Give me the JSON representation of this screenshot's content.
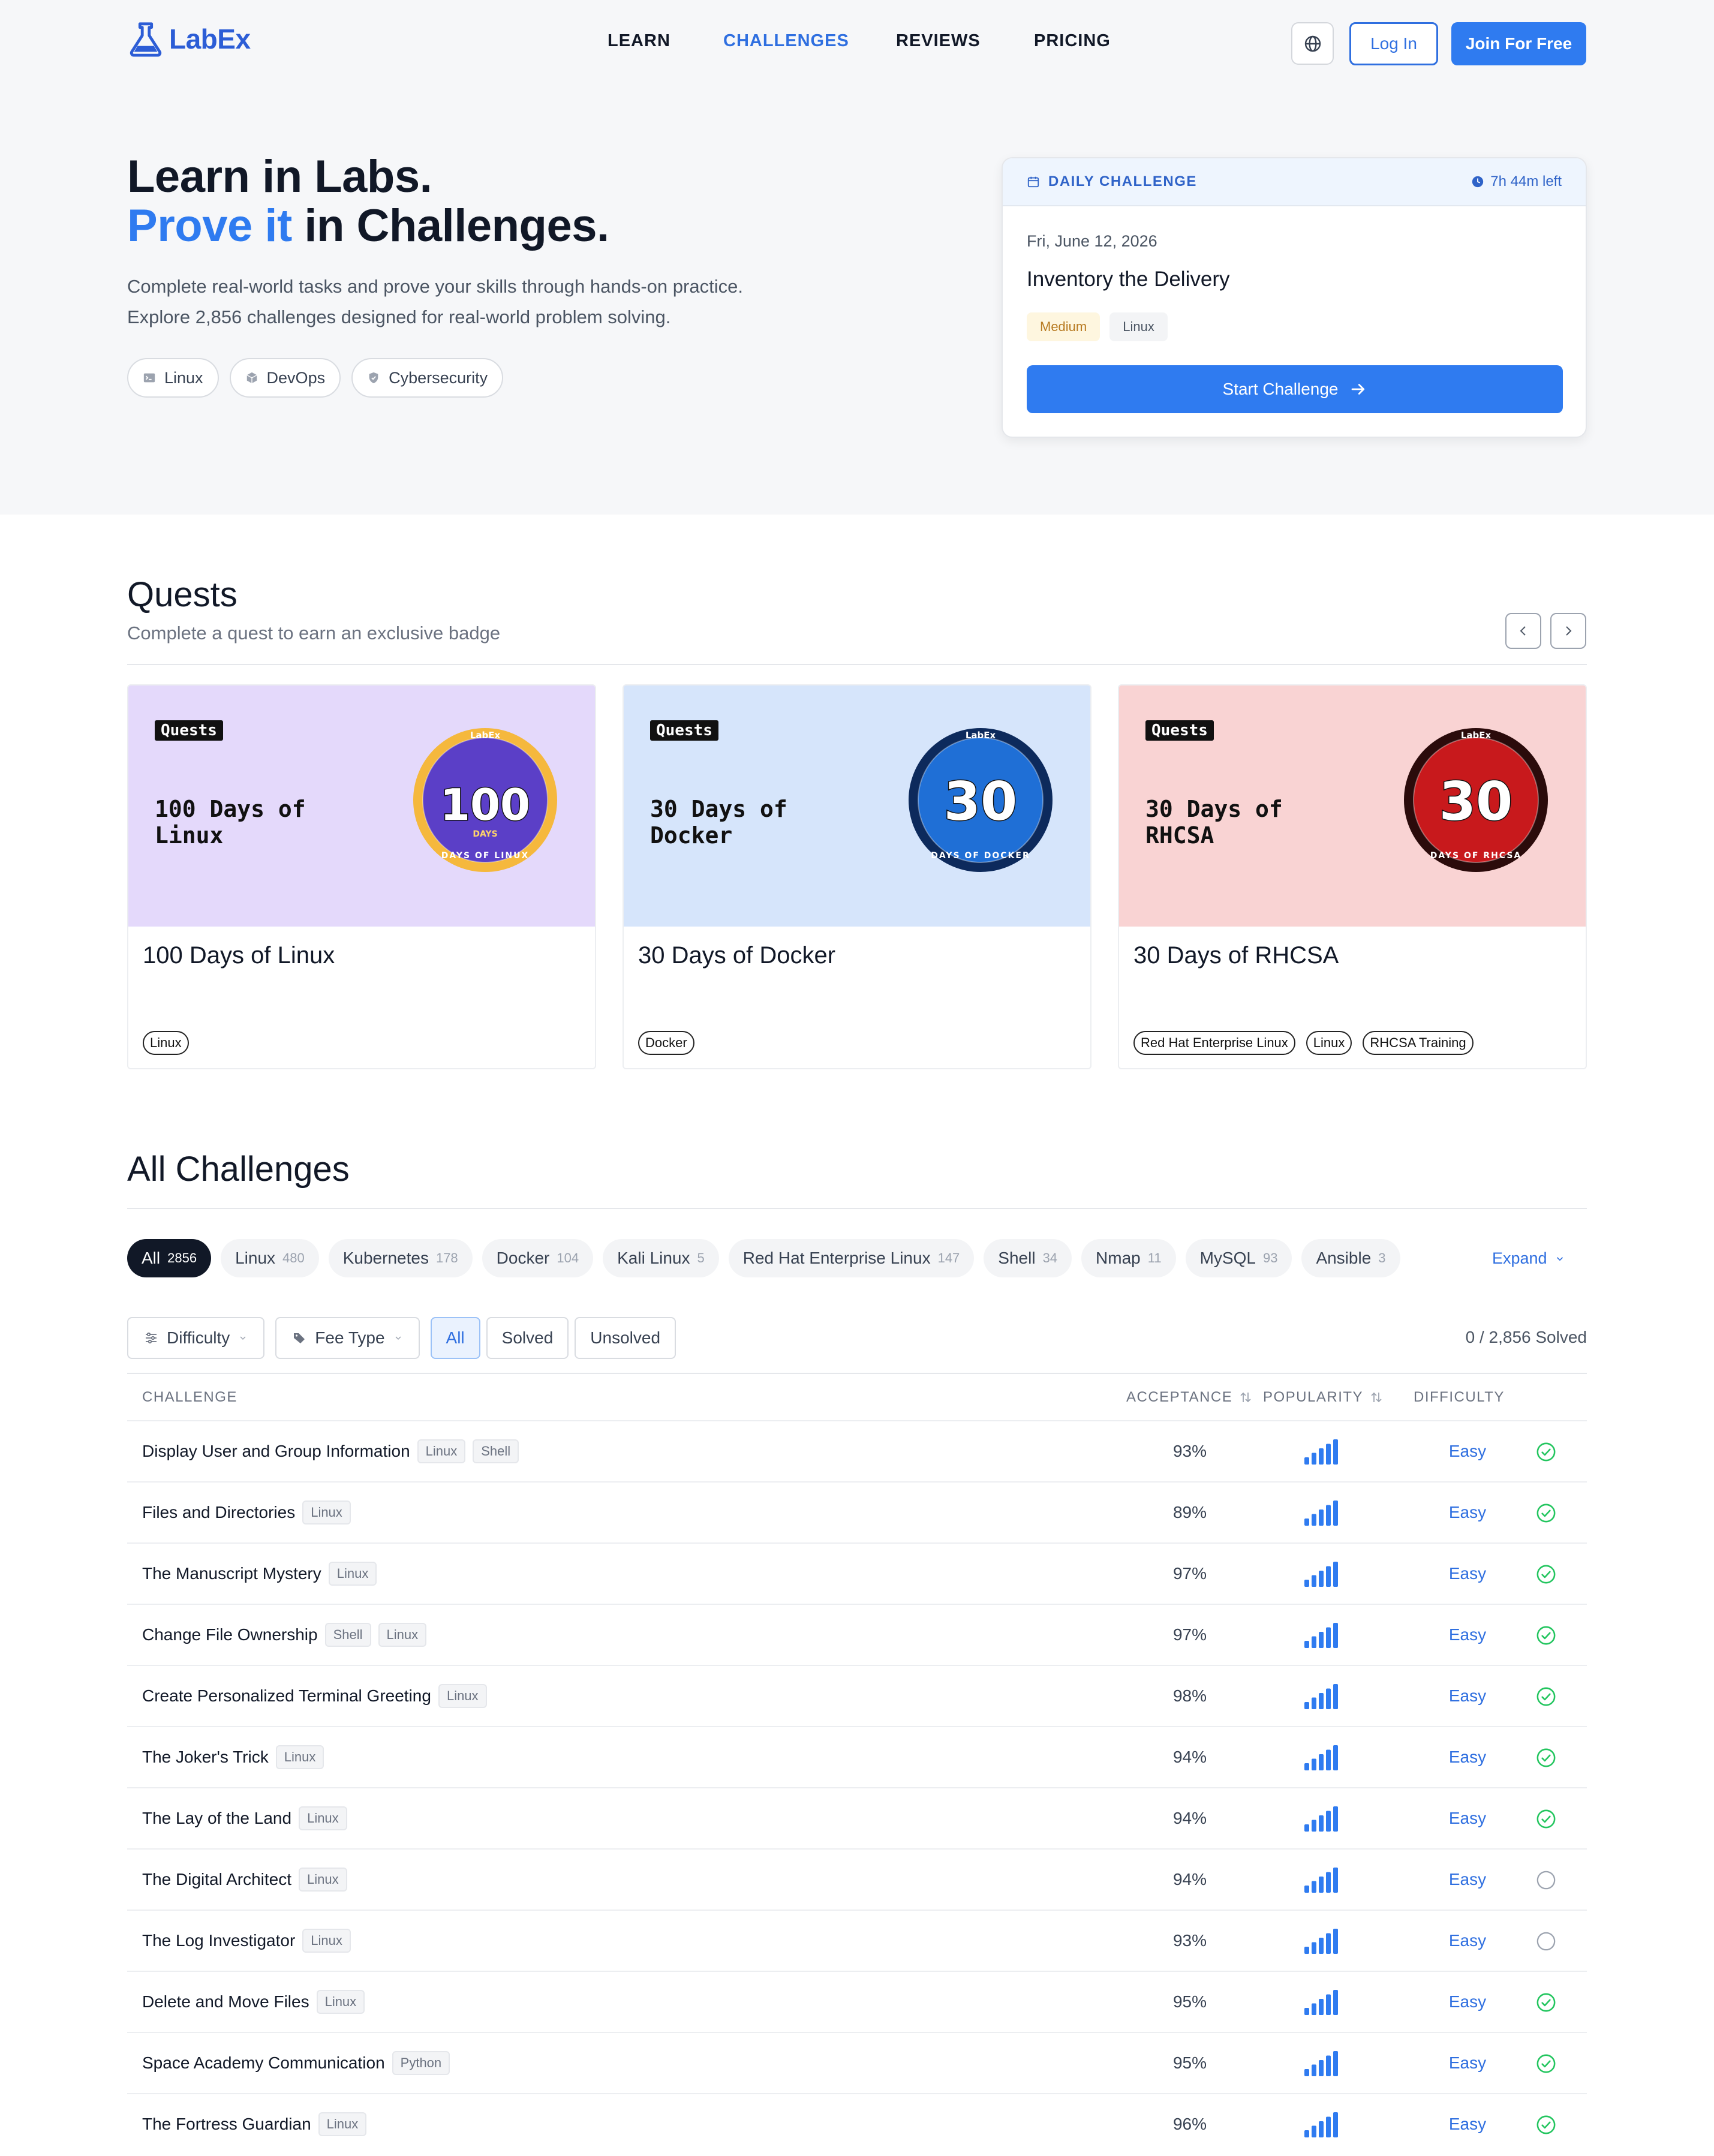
{
  "brand": {
    "name": "LabEx",
    "color": "#2c5dd6"
  },
  "nav": [
    {
      "label": "LEARN",
      "active": false
    },
    {
      "label": "CHALLENGES",
      "active": true
    },
    {
      "label": "REVIEWS",
      "active": false
    },
    {
      "label": "PRICING",
      "active": false
    }
  ],
  "header": {
    "globe_icon": "globe-icon",
    "login_label": "Log In",
    "join_label": "Join For Free"
  },
  "hero": {
    "title_line1": "Learn in Labs.",
    "title_line2_highlight": "Prove it",
    "title_line2_rest": "in Challenges.",
    "subtitle_line1": "Complete real-world tasks and prove your skills through hands-on practice.",
    "subtitle_line2": "Explore 2,856 challenges designed for real-world problem solving.",
    "topics": [
      {
        "label": "Linux",
        "icon": "terminal-icon"
      },
      {
        "label": "DevOps",
        "icon": "cube-icon"
      },
      {
        "label": "Cybersecurity",
        "icon": "shield-icon"
      }
    ]
  },
  "daily": {
    "label": "DAILY CHALLENGE",
    "time_left": "7h 44m left",
    "date": "Fri, June 12, 2026",
    "title": "Inventory the Delivery",
    "difficulty": "Medium",
    "tag": "Linux",
    "button": "Start Challenge"
  },
  "quests": {
    "title": "Quests",
    "subtitle": "Complete a quest to earn an exclusive badge",
    "items": [
      {
        "badge_label": "Quests",
        "banner_title": "100 Days of Linux",
        "medal_number": "100",
        "medal_sub": "DAYS",
        "medal_ring": "DAYS OF LINUX",
        "medal_top": "LabEx",
        "name": "100 Days of Linux",
        "tags": [
          "Linux"
        ],
        "bg": "#e4d9fb",
        "medal_color": "#5b3fc7",
        "rim_color": "#f5b83d"
      },
      {
        "badge_label": "Quests",
        "banner_title": "30 Days of Docker",
        "medal_number": "30",
        "medal_sub": "",
        "medal_ring": "DAYS OF DOCKER",
        "medal_top": "LabEx",
        "name": "30 Days of Docker",
        "tags": [
          "Docker"
        ],
        "bg": "#d6e5fb",
        "medal_color": "#1f6fd6",
        "rim_color": "#0d2a5c"
      },
      {
        "badge_label": "Quests",
        "banner_title": "30 Days of RHCSA",
        "medal_number": "30",
        "medal_sub": "",
        "medal_ring": "DAYS OF RHCSA",
        "medal_top": "LabEx",
        "name": "30 Days of RHCSA",
        "tags": [
          "Red Hat Enterprise Linux",
          "Linux",
          "RHCSA Training"
        ],
        "bg": "#f9d3d3",
        "medal_color": "#c8191c",
        "rim_color": "#2b0b0b"
      }
    ]
  },
  "all": {
    "title": "All Challenges",
    "categories": [
      {
        "label": "All",
        "count": "2856",
        "active": true
      },
      {
        "label": "Linux",
        "count": "480"
      },
      {
        "label": "Kubernetes",
        "count": "178"
      },
      {
        "label": "Docker",
        "count": "104"
      },
      {
        "label": "Kali Linux",
        "count": "5"
      },
      {
        "label": "Red Hat Enterprise Linux",
        "count": "147"
      },
      {
        "label": "Shell",
        "count": "34"
      },
      {
        "label": "Nmap",
        "count": "11"
      },
      {
        "label": "MySQL",
        "count": "93"
      },
      {
        "label": "Ansible",
        "count": "3"
      }
    ],
    "expand_label": "Expand",
    "filters": {
      "difficulty": "Difficulty",
      "fee_type": "Fee Type"
    },
    "segments": [
      {
        "label": "All",
        "active": true
      },
      {
        "label": "Solved"
      },
      {
        "label": "Unsolved"
      }
    ],
    "solved_count": "0 / 2,856 Solved",
    "columns": {
      "challenge": "CHALLENGE",
      "acceptance": "ACCEPTANCE",
      "popularity": "POPULARITY",
      "difficulty": "DIFFICULTY"
    },
    "rows": [
      {
        "name": "Display User and Group Information",
        "tags": [
          "Linux",
          "Shell"
        ],
        "acceptance": "93%",
        "popularity": 5,
        "difficulty": "Easy",
        "done": true
      },
      {
        "name": "Files and Directories",
        "tags": [
          "Linux"
        ],
        "acceptance": "89%",
        "popularity": 5,
        "difficulty": "Easy",
        "done": true
      },
      {
        "name": "The Manuscript Mystery",
        "tags": [
          "Linux"
        ],
        "acceptance": "97%",
        "popularity": 5,
        "difficulty": "Easy",
        "done": true
      },
      {
        "name": "Change File Ownership",
        "tags": [
          "Shell",
          "Linux"
        ],
        "acceptance": "97%",
        "popularity": 5,
        "difficulty": "Easy",
        "done": true
      },
      {
        "name": "Create Personalized Terminal Greeting",
        "tags": [
          "Linux"
        ],
        "acceptance": "98%",
        "popularity": 5,
        "difficulty": "Easy",
        "done": true
      },
      {
        "name": "The Joker's Trick",
        "tags": [
          "Linux"
        ],
        "acceptance": "94%",
        "popularity": 5,
        "difficulty": "Easy",
        "done": true
      },
      {
        "name": "The Lay of the Land",
        "tags": [
          "Linux"
        ],
        "acceptance": "94%",
        "popularity": 5,
        "difficulty": "Easy",
        "done": true
      },
      {
        "name": "The Digital Architect",
        "tags": [
          "Linux"
        ],
        "acceptance": "94%",
        "popularity": 5,
        "difficulty": "Easy",
        "done": false
      },
      {
        "name": "The Log Investigator",
        "tags": [
          "Linux"
        ],
        "acceptance": "93%",
        "popularity": 5,
        "difficulty": "Easy",
        "done": false
      },
      {
        "name": "Delete and Move Files",
        "tags": [
          "Linux"
        ],
        "acceptance": "95%",
        "popularity": 5,
        "difficulty": "Easy",
        "done": true
      },
      {
        "name": "Space Academy Communication",
        "tags": [
          "Python"
        ],
        "acceptance": "95%",
        "popularity": 5,
        "difficulty": "Easy",
        "done": true
      },
      {
        "name": "The Fortress Guardian",
        "tags": [
          "Linux"
        ],
        "acceptance": "96%",
        "popularity": 5,
        "difficulty": "Easy",
        "done": true
      }
    ]
  },
  "colors": {
    "accent": "#2f7bf0",
    "link": "#2f6fe0",
    "success": "#22c55e",
    "dark": "#111827"
  }
}
